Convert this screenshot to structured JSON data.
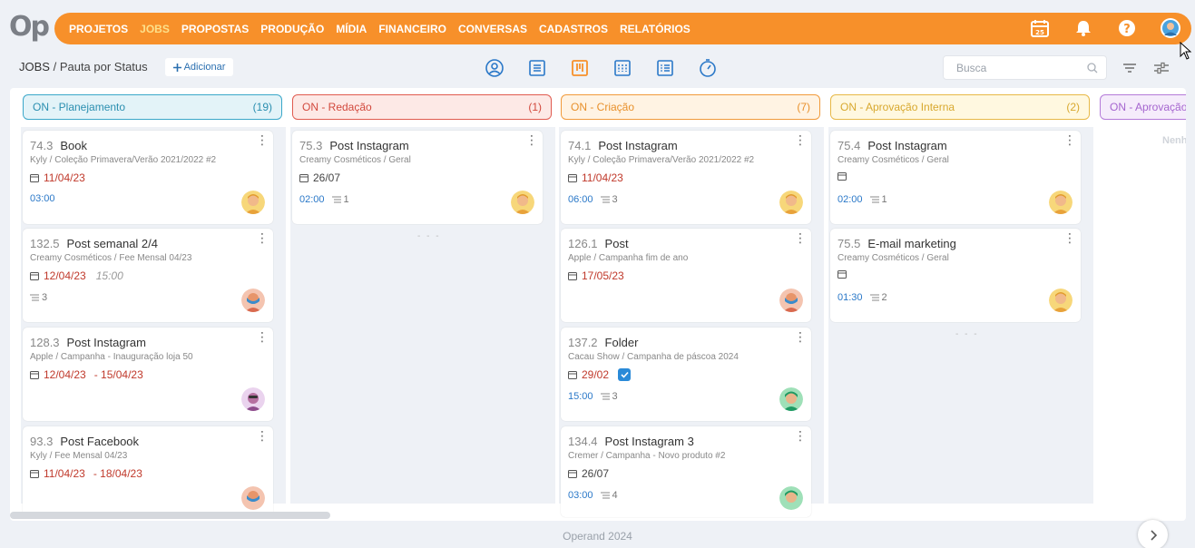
{
  "app": {
    "logo": "Op",
    "footer": "Operand 2024"
  },
  "nav": {
    "items": [
      "PROJETOS",
      "JOBS",
      "PROPOSTAS",
      "PRODUÇÃO",
      "MÍDIA",
      "FINANCEIRO",
      "CONVERSAS",
      "CADASTROS",
      "RELATÓRIOS"
    ],
    "active": "JOBS",
    "calendar_day": "25"
  },
  "header": {
    "breadcrumb_root": "JOBS",
    "breadcrumb_sep": " / ",
    "breadcrumb_page": "Pauta por Status",
    "add_label": "Adicionar",
    "search_placeholder": "Busca"
  },
  "columns": [
    {
      "title": "ON - Planejamento",
      "count": "(19)",
      "color": "#3aa7c9",
      "bg": "#e3f3f8"
    },
    {
      "title": "ON - Redação",
      "count": "(1)",
      "color": "#e05a4f",
      "bg": "#fde9e6"
    },
    {
      "title": "ON - Criação",
      "count": "(7)",
      "color": "#f19a3a",
      "bg": "#fff3e3"
    },
    {
      "title": "ON - Aprovação Interna",
      "count": "(2)",
      "color": "#e7b846",
      "bg": "#fff8e0"
    },
    {
      "title": "ON - Aprovação",
      "count": "",
      "color": "#b47ad8",
      "bg": "#f5ecfb"
    }
  ],
  "cards": {
    "c0": [
      {
        "num": "74.3",
        "title": "Book",
        "sub": "Kyly / Coleção Primavera/Verão 2021/2022 #2",
        "date": "11/04/23",
        "time": "03:00",
        "avatar": "yellow"
      },
      {
        "num": "132.5",
        "title": "Post semanal 2/4",
        "sub": "Creamy Cosméticos / Fee Mensal 04/23",
        "date": "12/04/23",
        "extra": "15:00",
        "count": "3",
        "avatar": "peach"
      },
      {
        "num": "128.3",
        "title": "Post Instagram",
        "sub": "Apple / Campanha - Inauguração loja 50",
        "date": "12/04/23",
        "date2": "- 15/04/23",
        "avatar": "purple"
      },
      {
        "num": "93.3",
        "title": "Post Facebook",
        "sub": "Kyly / Fee Mensal 04/23",
        "date": "11/04/23",
        "date2": "- 18/04/23",
        "avatar": "peach"
      }
    ],
    "c1": [
      {
        "num": "75.3",
        "title": "Post Instagram",
        "sub": "Creamy Cosméticos / Geral",
        "date": "26/07",
        "time": "02:00",
        "count": "1",
        "avatar": "yellow"
      }
    ],
    "c2": [
      {
        "num": "74.1",
        "title": "Post Instagram",
        "sub": "Kyly / Coleção Primavera/Verão 2021/2022 #2",
        "date": "11/04/23",
        "time": "06:00",
        "count": "3",
        "avatar": "yellow"
      },
      {
        "num": "126.1",
        "title": "Post",
        "sub": "Apple / Campanha fim de ano",
        "date": "17/05/23",
        "avatar": "peach"
      },
      {
        "num": "137.2",
        "title": "Folder",
        "sub": "Cacau Show / Campanha de páscoa 2024",
        "date": "29/02",
        "time": "15:00",
        "count": "3",
        "avatar": "green"
      },
      {
        "num": "134.4",
        "title": "Post Instagram 3",
        "sub": "Cremer / Campanha - Novo produto #2",
        "date": "26/07",
        "time": "03:00",
        "count": "4",
        "avatar": "green"
      }
    ],
    "c3": [
      {
        "num": "75.4",
        "title": "Post Instagram",
        "sub": "Creamy Cosméticos / Geral",
        "date": "",
        "time": "02:00",
        "count": "1",
        "avatar": "yellow"
      },
      {
        "num": "75.5",
        "title": "E-mail marketing",
        "sub": "Creamy Cosméticos / Geral",
        "date": "",
        "time": "01:30",
        "count": "2",
        "avatar": "yellow"
      }
    ],
    "c4_empty": "Nenhum"
  }
}
